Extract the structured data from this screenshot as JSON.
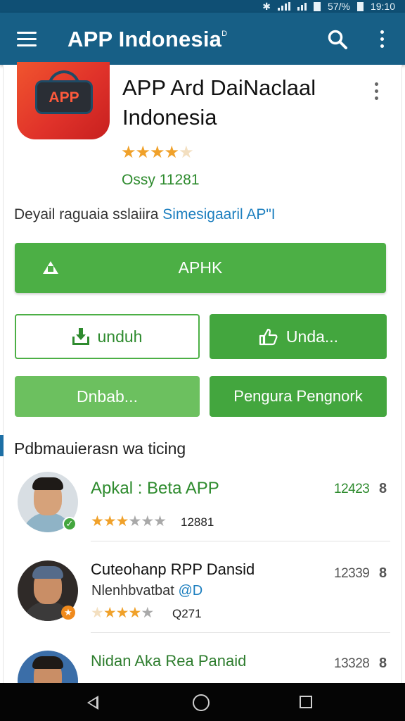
{
  "status_bar": {
    "battery": "57/%",
    "time": "19:10"
  },
  "app_bar": {
    "title": "APP Indonesia",
    "title_superscript": "D"
  },
  "app": {
    "icon_text": "APP",
    "name": "APP Ard DaiNaclaal Indonesia",
    "rating": 4.5,
    "meta": "Ossy 11281"
  },
  "description": {
    "text": "Deyail raguaia sslaiira",
    "link": "Simesigaaril",
    "suffix": "AP\"I"
  },
  "buttons": {
    "primary": "APHK",
    "download": "unduh",
    "secondary": "Unda...",
    "tertiary": "Dnbab...",
    "quaternary": "Pengura Pengnork"
  },
  "section": {
    "title": "Pdbmauierasn wa ticing"
  },
  "list": [
    {
      "title": "Apkal : Beta APP",
      "subtitle": "",
      "stars": 3.5,
      "rating_text": "12881",
      "count": "12423",
      "menu": "8",
      "badge": "check"
    },
    {
      "title": "Cuteohanp RPP Dansid",
      "subtitle": "Nlenhbvatbat",
      "subtitle_accent": "@D",
      "stars": 3.5,
      "rating_text": "Q271",
      "count": "12339",
      "menu": "8",
      "badge": "star"
    },
    {
      "title": "Nidan Aka Rea Panaid",
      "subtitle": "",
      "stars": 0,
      "rating_text": "",
      "count": "13328",
      "menu": "8",
      "badge": ""
    }
  ],
  "colors": {
    "app_bar": "#175f86",
    "status_bar": "#0f4f74",
    "green": "#4caf45",
    "link": "#1d7fbf"
  }
}
